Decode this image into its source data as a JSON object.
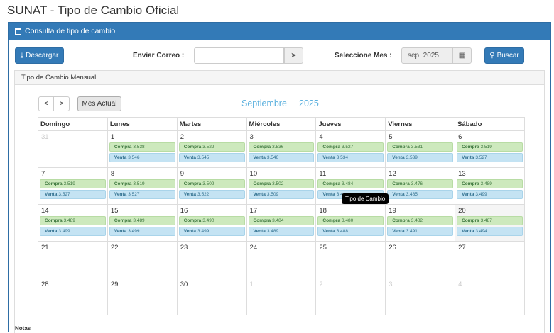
{
  "page_title": "SUNAT - Tipo de Cambio Oficial",
  "panel_title": "Consulta de tipo de cambio",
  "toolbar": {
    "download_label": "Descargar",
    "email_label": "Enviar Correo :",
    "email_value": "",
    "month_label": "Seleccione Mes :",
    "month_value": "sep. 2025",
    "search_label": "Buscar"
  },
  "sub_panel_title": "Tipo de Cambio Mensual",
  "calendar": {
    "prev": "<",
    "next": ">",
    "current_month_button": "Mes Actual",
    "month_name": "Septiembre",
    "year": "2025",
    "weekdays": [
      "Domingo",
      "Lunes",
      "Martes",
      "Miércoles",
      "Jueves",
      "Viernes",
      "Sábado"
    ],
    "weeks": [
      [
        {
          "d": "31",
          "other": true
        },
        {
          "d": "1",
          "c": "3.538",
          "v": "3.546"
        },
        {
          "d": "2",
          "c": "3.522",
          "v": "3.545"
        },
        {
          "d": "3",
          "c": "3.536",
          "v": "3.546"
        },
        {
          "d": "4",
          "c": "3.527",
          "v": "3.534"
        },
        {
          "d": "5",
          "c": "3.531",
          "v": "3.539"
        },
        {
          "d": "6",
          "c": "3.519",
          "v": "3.527"
        }
      ],
      [
        {
          "d": "7",
          "c": "3.519",
          "v": "3.527"
        },
        {
          "d": "8",
          "c": "3.519",
          "v": "3.527"
        },
        {
          "d": "9",
          "c": "3.509",
          "v": "3.522"
        },
        {
          "d": "10",
          "c": "3.502",
          "v": "3.509"
        },
        {
          "d": "11",
          "c": "3.484",
          "v": "3.4"
        },
        {
          "d": "12",
          "c": "3.476",
          "v": "3.485"
        },
        {
          "d": "13",
          "c": "3.489",
          "v": "3.499"
        }
      ],
      [
        {
          "d": "14",
          "c": "3.489",
          "v": "3.499"
        },
        {
          "d": "15",
          "c": "3.489",
          "v": "3.499"
        },
        {
          "d": "16",
          "c": "3.490",
          "v": "3.499"
        },
        {
          "d": "17",
          "c": "3.484",
          "v": "3.489"
        },
        {
          "d": "18",
          "c": "3.480",
          "v": "3.488"
        },
        {
          "d": "19",
          "c": "3.482",
          "v": "3.491"
        },
        {
          "d": "20",
          "c": "3.487",
          "v": "3.494",
          "today": true
        }
      ],
      [
        {
          "d": "21"
        },
        {
          "d": "22"
        },
        {
          "d": "23"
        },
        {
          "d": "24"
        },
        {
          "d": "25"
        },
        {
          "d": "26"
        },
        {
          "d": "27"
        }
      ],
      [
        {
          "d": "28"
        },
        {
          "d": "29"
        },
        {
          "d": "30"
        },
        {
          "d": "1",
          "other": true
        },
        {
          "d": "2",
          "other": true
        },
        {
          "d": "3",
          "other": true
        },
        {
          "d": "4",
          "other": true
        }
      ]
    ],
    "compra_label": "Compra",
    "venta_label": "Venta"
  },
  "tooltip": "Tipo de Cambio",
  "notes_label": "Notas",
  "icons": {
    "panel": "calendar-icon",
    "download": "download-icon",
    "send": "paper-plane-icon",
    "month_picker": "calendar-icon",
    "search": "search-icon"
  }
}
